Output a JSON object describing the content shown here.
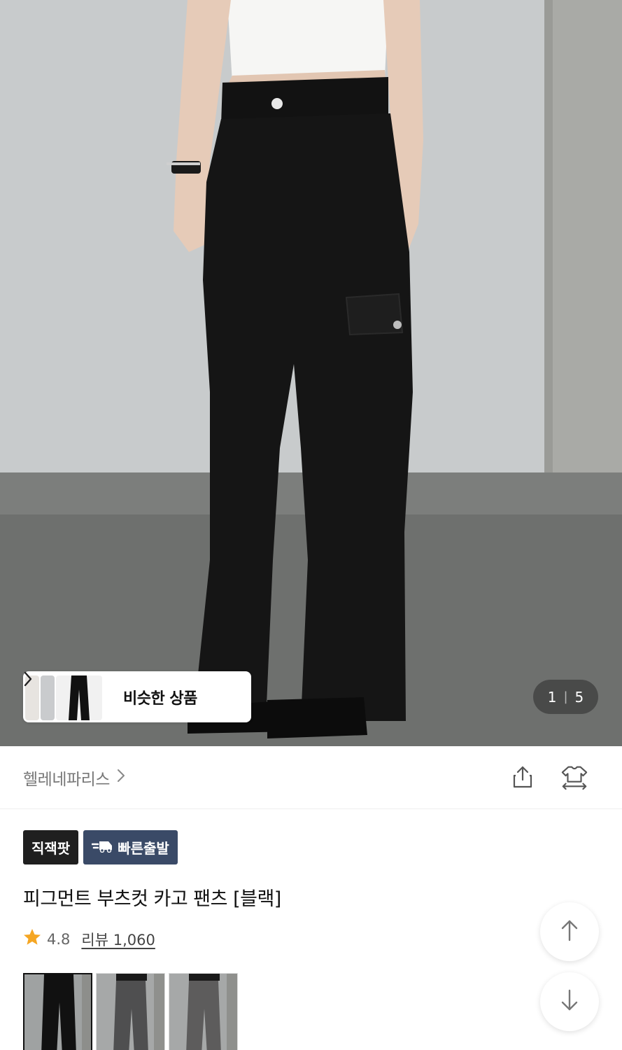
{
  "gallery": {
    "similar_label": "비슷한 상품",
    "chevron_icon": "chevron-right-icon",
    "pager_current": "1",
    "pager_total": "5"
  },
  "brand": {
    "name": "헬레네파리스",
    "share_icon": "share-icon",
    "wardrobe_icon": "wardrobe-compare-icon"
  },
  "badges": {
    "direct": "직잭팟",
    "fast_delivery": "빠른출발",
    "fast_icon": "delivery-truck-icon"
  },
  "product": {
    "title": "피그먼트 부츠컷 카고 팬츠 [블랙]",
    "rating": "4.8",
    "review_label": "리뷰 1,060"
  },
  "colors": {
    "options": [
      "black",
      "charcoal",
      "gray"
    ],
    "selected_index": 0
  },
  "scroll": {
    "up_icon": "arrow-up-icon",
    "down_icon": "arrow-down-icon"
  },
  "theme": {
    "star_color": "#f5a623",
    "fast_badge_color": "#3a4a67",
    "dark_badge_color": "#1f1f1f"
  }
}
